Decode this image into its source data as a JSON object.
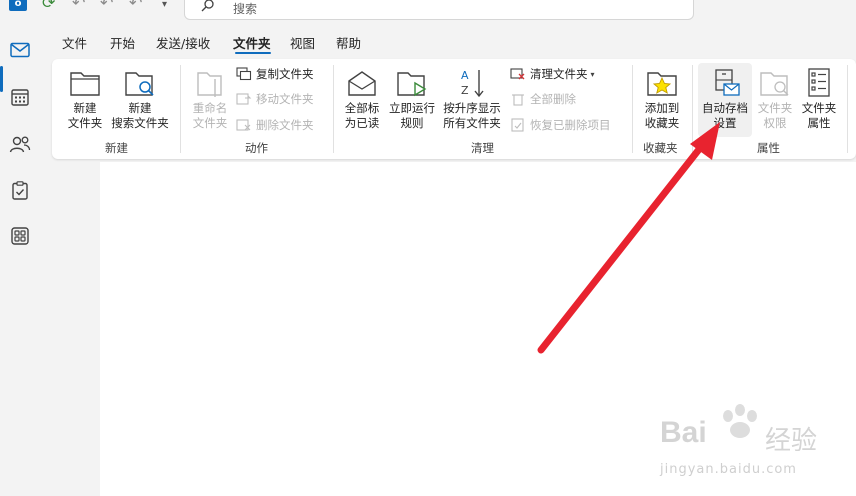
{
  "titlebar": {
    "logo_text": "o",
    "search_placeholder": "搜索"
  },
  "tabs": [
    {
      "label": "文件"
    },
    {
      "label": "开始"
    },
    {
      "label": "发送/接收"
    },
    {
      "label": "文件夹"
    },
    {
      "label": "视图"
    },
    {
      "label": "帮助"
    }
  ],
  "active_tab": "文件夹",
  "ribbon": {
    "groups": {
      "new": "新建",
      "actions": "动作",
      "cleanup": "清理",
      "favorites": "收藏夹",
      "properties": "属性"
    },
    "buttons": {
      "new_folder": "新建\n文件夹",
      "new_search_folder": "新建\n搜索文件夹",
      "rename_folder": "重命名\n文件夹",
      "copy_folder": "复制文件夹",
      "move_folder": "移动文件夹",
      "delete_folder": "删除文件夹",
      "mark_all_read": "全部标\n为已读",
      "run_rules_now": "立即运行\n规则",
      "sort_ascending": "按升序显示\n所有文件夹",
      "clean_up_folder": "清理文件夹",
      "delete_all": "全部删除",
      "recover_deleted": "恢复已删除项目",
      "add_to_favorites": "添加到\n收藏夹",
      "autoarchive_settings": "自动存档\n设置",
      "folder_permissions": "文件夹\n权限",
      "folder_properties": "文件夹\n属性"
    }
  },
  "colors": {
    "accent": "#0f6cbd",
    "annotation_arrow": "#e8232f",
    "disabled_text": "#b3b3b3"
  },
  "watermark": {
    "brand": "Bai",
    "brand_suffix": "经验",
    "url": "jingyan.baidu.com"
  }
}
